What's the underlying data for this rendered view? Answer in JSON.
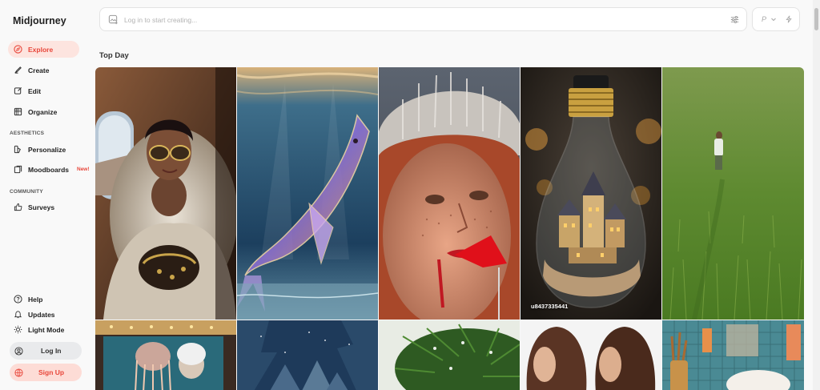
{
  "app": {
    "brand": "Midjourney"
  },
  "nav": {
    "explore": "Explore",
    "create": "Create",
    "edit": "Edit",
    "organize": "Organize",
    "aesthetics_label": "AESTHETICS",
    "personalize": "Personalize",
    "moodboards": "Moodboards",
    "moodboards_badge": "New!",
    "community_label": "COMMUNITY",
    "surveys": "Surveys",
    "help": "Help",
    "updates": "Updates",
    "light_mode": "Light Mode",
    "log_in": "Log In",
    "sign_up": "Sign Up"
  },
  "prompt": {
    "placeholder": "Log in to start creating..."
  },
  "mode": {
    "label": "P"
  },
  "gallery": {
    "title": "Top Day",
    "tiles": [
      {
        "subject": "woman in fur coat on plane"
      },
      {
        "subject": "glass whale underwater"
      },
      {
        "subject": "freckled face with crown and red candy"
      },
      {
        "subject": "miniature village in light bulb",
        "caption": "u8437335441"
      },
      {
        "subject": "man in tall grass field"
      },
      {
        "subject": "jellyfish aquarium"
      },
      {
        "subject": "snowy forest"
      },
      {
        "subject": "pine branch"
      },
      {
        "subject": "two women brown hair"
      },
      {
        "subject": "teal tiled kitchen"
      }
    ]
  },
  "colors": {
    "accent": "#e8463a",
    "active_bg": "#fde4df"
  }
}
